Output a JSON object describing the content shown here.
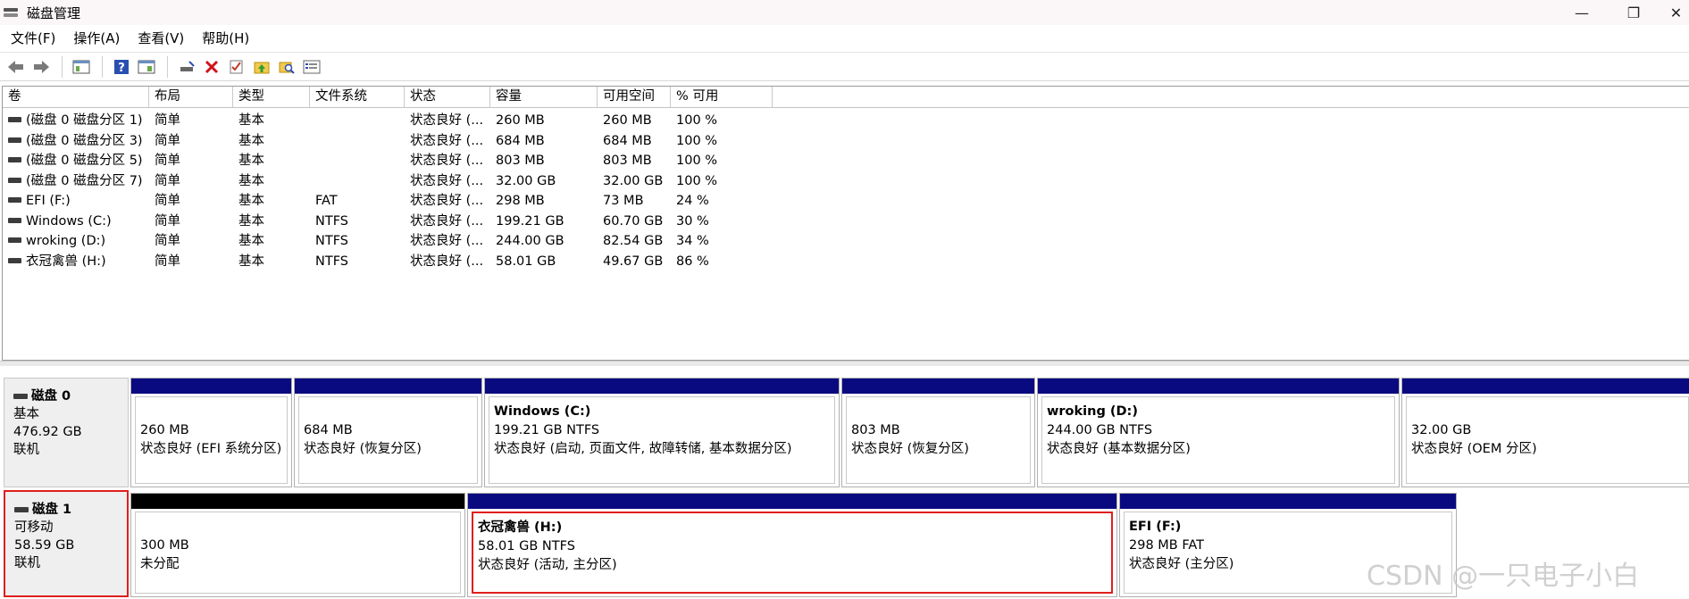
{
  "window": {
    "title": "磁盘管理",
    "minimize": "—",
    "maximize": "❐",
    "close": "✕"
  },
  "menu": [
    "文件(F)",
    "操作(A)",
    "查看(V)",
    "帮助(H)"
  ],
  "toolbar": {
    "icons": [
      "back-icon",
      "forward-icon",
      "console-tree-icon",
      "help-icon",
      "properties-icon",
      "connect-icon",
      "delete-icon",
      "check-icon",
      "up-icon",
      "find-icon",
      "settings-icon"
    ]
  },
  "volume_list": {
    "columns": [
      "卷",
      "布局",
      "类型",
      "文件系统",
      "状态",
      "容量",
      "可用空间",
      "% 可用"
    ],
    "rows": [
      [
        "(磁盘 0 磁盘分区 1)",
        "简单",
        "基本",
        "",
        "状态良好 (...",
        "260 MB",
        "260 MB",
        "100 %"
      ],
      [
        "(磁盘 0 磁盘分区 3)",
        "简单",
        "基本",
        "",
        "状态良好 (...",
        "684 MB",
        "684 MB",
        "100 %"
      ],
      [
        "(磁盘 0 磁盘分区 5)",
        "简单",
        "基本",
        "",
        "状态良好 (...",
        "803 MB",
        "803 MB",
        "100 %"
      ],
      [
        "(磁盘 0 磁盘分区 7)",
        "简单",
        "基本",
        "",
        "状态良好 (...",
        "32.00 GB",
        "32.00 GB",
        "100 %"
      ],
      [
        "EFI (F:)",
        "简单",
        "基本",
        "FAT",
        "状态良好 (...",
        "298 MB",
        "73 MB",
        "24 %"
      ],
      [
        "Windows (C:)",
        "简单",
        "基本",
        "NTFS",
        "状态良好 (...",
        "199.21 GB",
        "60.70 GB",
        "30 %"
      ],
      [
        "wroking (D:)",
        "简单",
        "基本",
        "NTFS",
        "状态良好 (...",
        "244.00 GB",
        "82.54 GB",
        "34 %"
      ],
      [
        "衣冠禽兽 (H:)",
        "简单",
        "基本",
        "NTFS",
        "状态良好 (...",
        "58.01 GB",
        "49.67 GB",
        "86 %"
      ]
    ]
  },
  "disks": [
    {
      "name": "磁盘 0",
      "type": "基本",
      "size": "476.92 GB",
      "status": "联机",
      "partitions": [
        {
          "name": "",
          "size": "260 MB",
          "status": "状态良好 (EFI 系统分区)"
        },
        {
          "name": "",
          "size": "684 MB",
          "status": "状态良好 (恢复分区)"
        },
        {
          "name": "Windows  (C:)",
          "size": "199.21 GB NTFS",
          "status": "状态良好 (启动, 页面文件, 故障转储, 基本数据分区)"
        },
        {
          "name": "",
          "size": "803 MB",
          "status": "状态良好 (恢复分区)"
        },
        {
          "name": "wroking  (D:)",
          "size": "244.00 GB NTFS",
          "status": "状态良好 (基本数据分区)"
        },
        {
          "name": "",
          "size": "32.00 GB",
          "status": "状态良好 (OEM 分区)"
        }
      ]
    },
    {
      "name": "磁盘 1",
      "type": "可移动",
      "size": "58.59 GB",
      "status": "联机",
      "partitions": [
        {
          "name": "",
          "size": "300 MB",
          "status": "未分配"
        },
        {
          "name": "衣冠禽兽  (H:)",
          "size": "58.01 GB NTFS",
          "status": "状态良好 (活动, 主分区)"
        },
        {
          "name": "EFI  (F:)",
          "size": "298 MB FAT",
          "status": "状态良好 (主分区)"
        }
      ]
    }
  ],
  "watermark": "CSDN @一只电子小白",
  "colors": {
    "partition_bar": "#0a0a80",
    "unallocated_bar": "#000000",
    "selection_outline": "#e01e1e"
  }
}
